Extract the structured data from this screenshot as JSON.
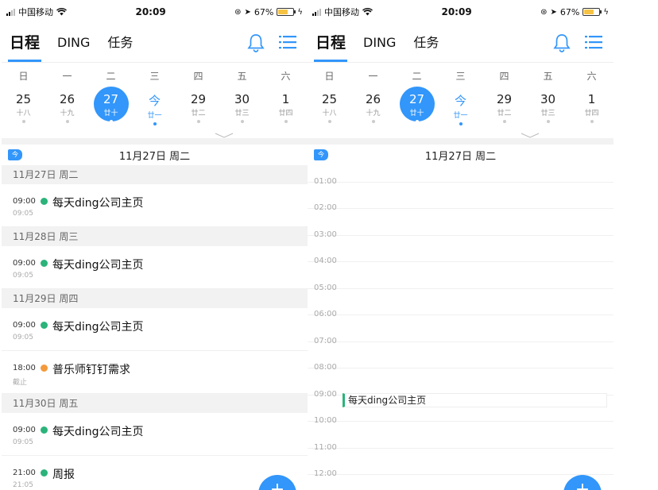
{
  "status": {
    "carrier": "中国移动",
    "time": "20:09",
    "battery": "67%"
  },
  "nav": {
    "tabs": [
      "日程",
      "DING",
      "任务"
    ]
  },
  "calendar": {
    "weekdays": [
      "日",
      "一",
      "二",
      "三",
      "四",
      "五",
      "六"
    ],
    "days": [
      {
        "num": "25",
        "lunar": "十八"
      },
      {
        "num": "26",
        "lunar": "十九"
      },
      {
        "num": "27",
        "lunar": "廿十"
      },
      {
        "num": "今",
        "lunar": "廿一"
      },
      {
        "num": "29",
        "lunar": "廿二"
      },
      {
        "num": "30",
        "lunar": "廿三"
      },
      {
        "num": "1",
        "lunar": "廿四"
      }
    ]
  },
  "today_badge": "今",
  "current_date": "11月27日 周二",
  "agenda": [
    {
      "header": "11月27日 周二",
      "events": [
        {
          "start": "09:00",
          "end": "09:05",
          "title": "每天ding公司主页",
          "color": "#2bb37a"
        }
      ]
    },
    {
      "header": "11月28日 周三",
      "events": [
        {
          "start": "09:00",
          "end": "09:05",
          "title": "每天ding公司主页",
          "color": "#2bb37a"
        }
      ]
    },
    {
      "header": "11月29日 周四",
      "events": [
        {
          "start": "09:00",
          "end": "09:05",
          "title": "每天ding公司主页",
          "color": "#2bb37a"
        },
        {
          "start": "18:00",
          "end": "截止",
          "title": "普乐师钉钉需求",
          "color": "#f39a3c"
        }
      ]
    },
    {
      "header": "11月30日 周五",
      "events": [
        {
          "start": "09:00",
          "end": "09:05",
          "title": "每天ding公司主页",
          "color": "#2bb37a"
        },
        {
          "start": "21:00",
          "end": "21:05",
          "title": "周报",
          "color": "#2bb37a"
        }
      ]
    }
  ],
  "timeline": {
    "hours": [
      "01:00",
      "02:00",
      "03:00",
      "04:00",
      "05:00",
      "06:00",
      "07:00",
      "08:00",
      "09:00",
      "10:00",
      "11:00",
      "12:00"
    ],
    "event": {
      "title": "每天ding公司主页"
    }
  },
  "fab_label": "+"
}
